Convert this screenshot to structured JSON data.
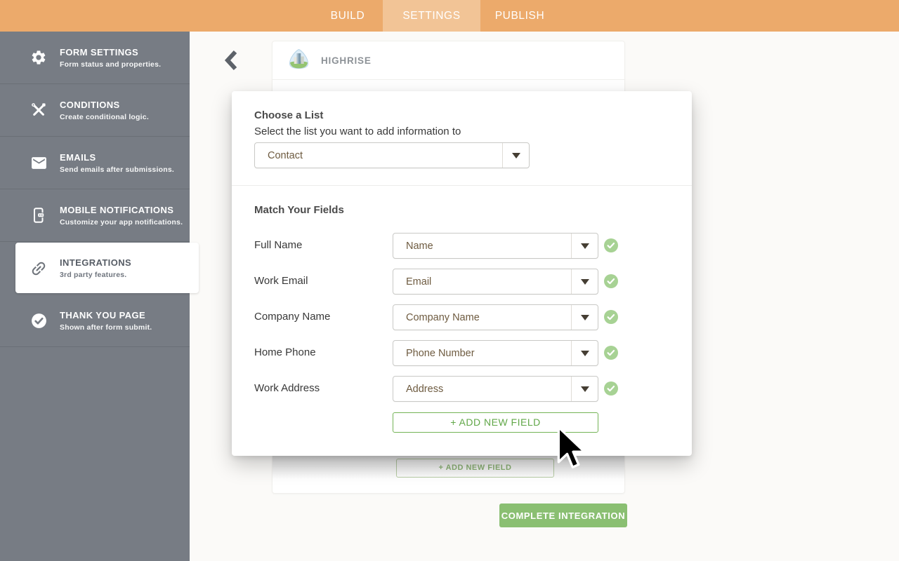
{
  "topbar": {
    "tabs": [
      {
        "label": "BUILD",
        "active": false
      },
      {
        "label": "SETTINGS",
        "active": true
      },
      {
        "label": "PUBLISH",
        "active": false
      }
    ]
  },
  "sidebar": {
    "items": [
      {
        "icon": "gear-icon",
        "title": "FORM SETTINGS",
        "subtitle": "Form status and properties.",
        "active": false
      },
      {
        "icon": "tools-icon",
        "title": "CONDITIONS",
        "subtitle": "Create conditional logic.",
        "active": false
      },
      {
        "icon": "envelope-icon",
        "title": "EMAILS",
        "subtitle": "Send emails after submissions.",
        "active": false
      },
      {
        "icon": "mobile-chat-icon",
        "title": "MOBILE NOTIFICATIONS",
        "subtitle": "Customize your app notifications.",
        "active": false
      },
      {
        "icon": "link-icon",
        "title": "INTEGRATIONS",
        "subtitle": "3rd party features.",
        "active": true
      },
      {
        "icon": "check-circle-icon",
        "title": "THANK YOU PAGE",
        "subtitle": "Shown after form submit.",
        "active": false
      }
    ]
  },
  "integration_panel": {
    "app_name": "HIGHRISE",
    "app_icon": "highrise-logo",
    "background_add_field_label": "+ ADD NEW FIELD",
    "complete_button_label": "COMPLETE INTEGRATION"
  },
  "modal": {
    "choose_list": {
      "title": "Choose a List",
      "subtitle": "Select the list you want to add information to",
      "selected_value": "Contact"
    },
    "match_fields": {
      "title": "Match Your Fields",
      "rows": [
        {
          "label": "Full Name",
          "value": "Name",
          "matched": true
        },
        {
          "label": "Work Email",
          "value": "Email",
          "matched": true
        },
        {
          "label": "Company Name",
          "value": "Company Name",
          "matched": true
        },
        {
          "label": "Home Phone",
          "value": "Phone Number",
          "matched": true
        },
        {
          "label": "Work Address",
          "value": "Address",
          "matched": true
        }
      ]
    },
    "add_field_label": "+ ADD NEW FIELD"
  },
  "colors": {
    "topbar_orange": "#ecaa6b",
    "active_tab_orange": "#f2c496",
    "sidebar_gray": "#777c84",
    "green_outline": "#74b356",
    "green_fill": "#8abf72",
    "check_green": "#a7d294",
    "select_value_brown": "#6e5b40"
  }
}
